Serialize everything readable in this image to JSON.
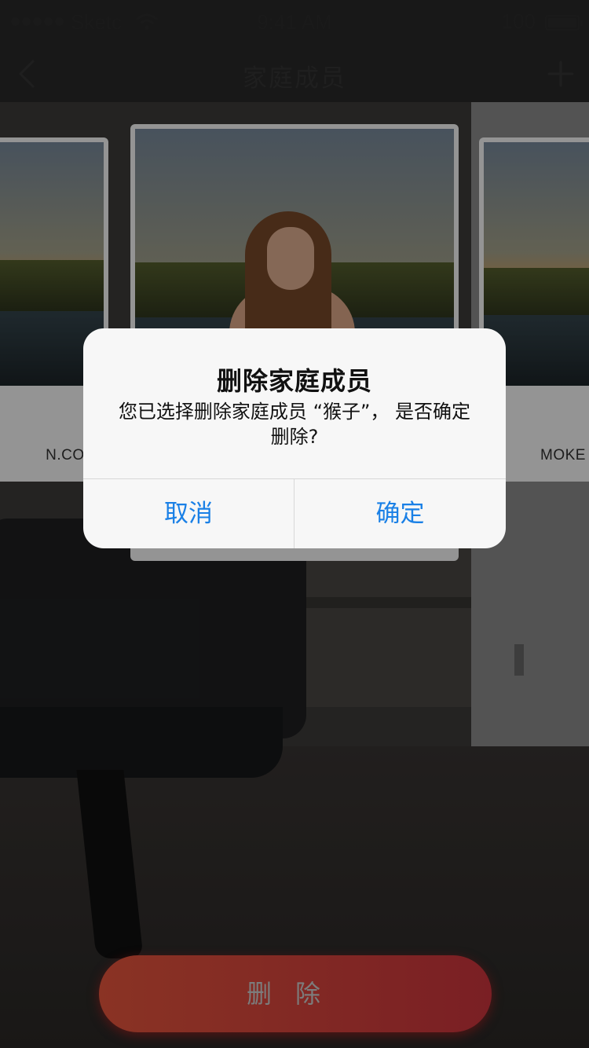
{
  "status_bar": {
    "carrier": "Sketc",
    "time": "9:41 AM",
    "battery": "100",
    "battery_level": 1.0
  },
  "nav": {
    "title": "家庭成员",
    "back_icon": "chevron-left-icon",
    "add_icon": "plus-icon"
  },
  "cards": [
    {
      "caption": "N.COM"
    },
    {
      "caption": ""
    },
    {
      "caption": "MOKE"
    }
  ],
  "alert": {
    "title": "删除家庭成员",
    "message": "您已选择删除家庭成员 “猴子”， 是否确定删除?",
    "cancel_label": "取消",
    "confirm_label": "确定"
  },
  "delete_button": {
    "label": "删除"
  },
  "colors": {
    "accent_blue": "#1a80e6",
    "delete_button_start": "#8a3324",
    "delete_button_end": "#7a1f24"
  }
}
